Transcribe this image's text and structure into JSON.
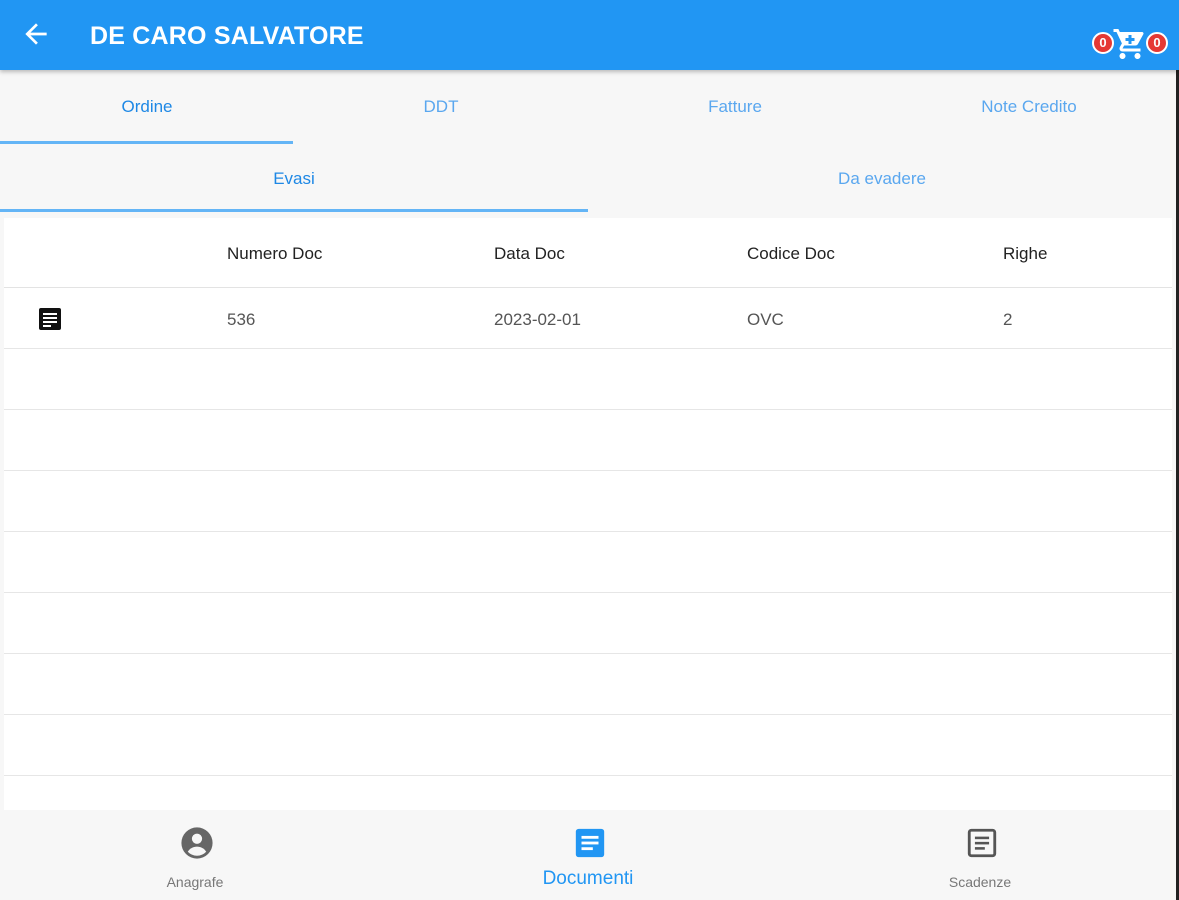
{
  "appbar": {
    "title": "DE CARO SALVATORE",
    "cart_left_count": "0",
    "cart_right_count": "0"
  },
  "tabs_primary": [
    {
      "label": "Ordine",
      "active": true
    },
    {
      "label": "DDT",
      "active": false
    },
    {
      "label": "Fatture",
      "active": false
    },
    {
      "label": "Note Credito",
      "active": false
    }
  ],
  "tabs_secondary": [
    {
      "label": "Evasi",
      "active": true
    },
    {
      "label": "Da evadere",
      "active": false
    }
  ],
  "table": {
    "columns": [
      "Numero Doc",
      "Data Doc",
      "Codice Doc",
      "Righe"
    ],
    "rows": [
      {
        "icon": "document-icon",
        "numero": "536",
        "data": "2023-02-01",
        "codice": "OVC",
        "righe": "2"
      }
    ]
  },
  "bottom_nav": [
    {
      "label": "Anagrafe",
      "icon": "account-circle-icon",
      "active": false
    },
    {
      "label": "Documenti",
      "icon": "document-icon",
      "active": true
    },
    {
      "label": "Scadenze",
      "icon": "article-icon",
      "active": false
    }
  ],
  "colors": {
    "primary": "#2196f3",
    "badge": "#e53935",
    "tab_text": "#5aa7ef"
  }
}
